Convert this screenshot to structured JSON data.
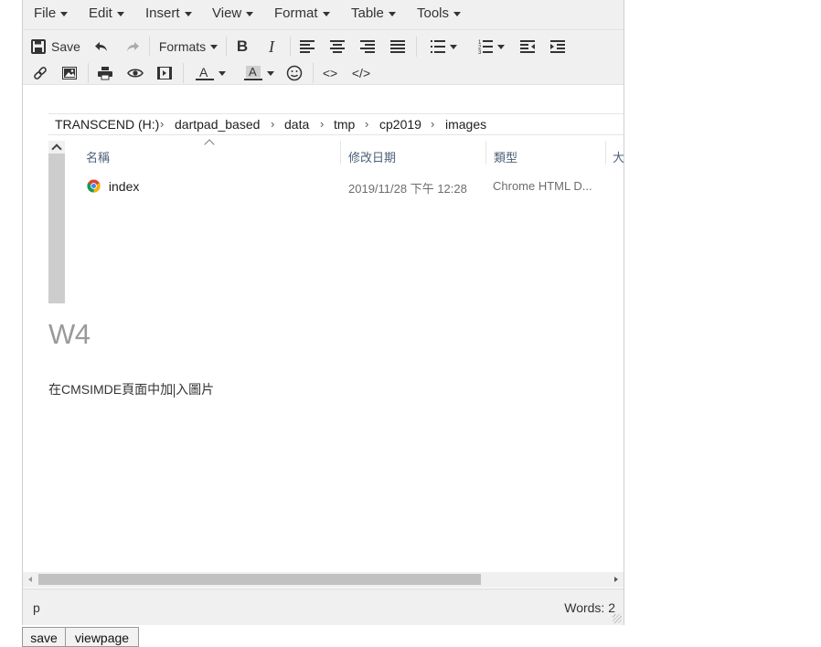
{
  "menubar": {
    "items": [
      {
        "label": "File"
      },
      {
        "label": "Edit"
      },
      {
        "label": "Insert"
      },
      {
        "label": "View"
      },
      {
        "label": "Format"
      },
      {
        "label": "Table"
      },
      {
        "label": "Tools"
      }
    ]
  },
  "toolbar": {
    "save_label": "Save",
    "formats_label": "Formats",
    "bold_label": "B",
    "italic_label": "I",
    "source_label": "<>",
    "code_label": "</>"
  },
  "explorer": {
    "breadcrumb": [
      "TRANSCEND (H:)",
      "dartpad_based",
      "data",
      "tmp",
      "cp2019",
      "images"
    ],
    "columns": {
      "name": "名稱",
      "modified": "修改日期",
      "type": "類型",
      "size": "大"
    },
    "file": {
      "name": "index",
      "modified": "2019/11/28 下午 12:28",
      "type": "Chrome HTML D..."
    }
  },
  "document": {
    "heading": "W4",
    "paragraph_before": "在CMSIMDE頁面中加",
    "paragraph_after": "入圖片"
  },
  "statusbar": {
    "path": "p",
    "words": "Words: 2"
  },
  "buttons": {
    "save": "save",
    "viewpage": "viewpage"
  },
  "colors": {
    "chrome_bg": "#f0f0f0",
    "heading_gray": "#9a9a9a",
    "explorer_header": "#4c607a"
  }
}
